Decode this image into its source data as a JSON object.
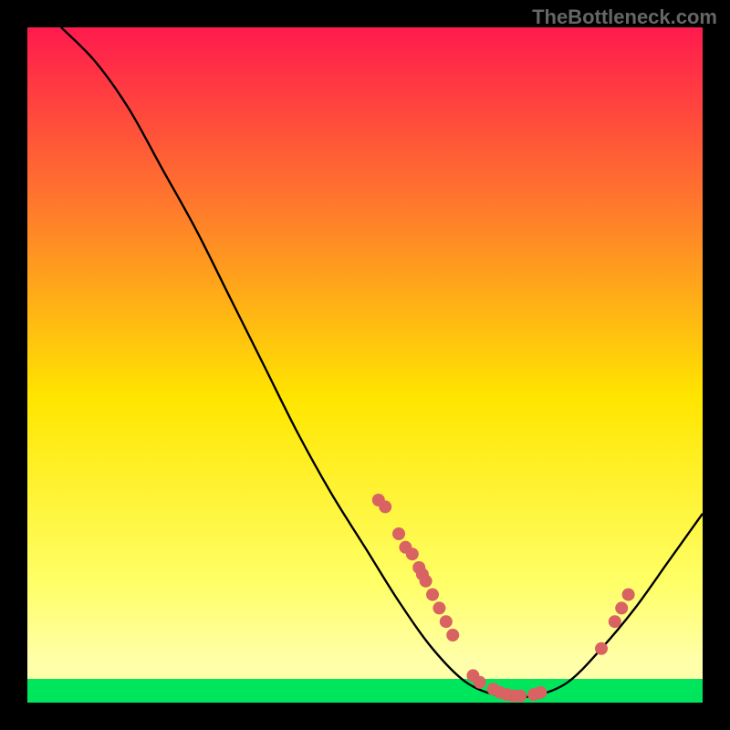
{
  "watermark": "TheBottleneck.com",
  "chart_data": {
    "type": "line",
    "title": "",
    "xlabel": "",
    "ylabel": "",
    "xlim": [
      0,
      100
    ],
    "ylim": [
      0,
      100
    ],
    "background_gradient": {
      "top": "#ff1a4d",
      "mid1": "#ff7f2a",
      "mid2": "#ffe600",
      "mid3": "#ffff66",
      "bottom_band": "#00e65c"
    },
    "curve": [
      {
        "x": 5,
        "y": 100
      },
      {
        "x": 10,
        "y": 95
      },
      {
        "x": 15,
        "y": 88
      },
      {
        "x": 20,
        "y": 79
      },
      {
        "x": 25,
        "y": 70
      },
      {
        "x": 30,
        "y": 60
      },
      {
        "x": 35,
        "y": 50
      },
      {
        "x": 40,
        "y": 40
      },
      {
        "x": 45,
        "y": 31
      },
      {
        "x": 50,
        "y": 23
      },
      {
        "x": 55,
        "y": 15
      },
      {
        "x": 60,
        "y": 8
      },
      {
        "x": 65,
        "y": 3
      },
      {
        "x": 70,
        "y": 1
      },
      {
        "x": 75,
        "y": 1
      },
      {
        "x": 80,
        "y": 3
      },
      {
        "x": 85,
        "y": 8
      },
      {
        "x": 90,
        "y": 14
      },
      {
        "x": 95,
        "y": 21
      },
      {
        "x": 100,
        "y": 28
      }
    ],
    "markers": [
      {
        "x": 52,
        "y": 30
      },
      {
        "x": 53,
        "y": 29
      },
      {
        "x": 55,
        "y": 25
      },
      {
        "x": 56,
        "y": 23
      },
      {
        "x": 57,
        "y": 22
      },
      {
        "x": 58,
        "y": 20
      },
      {
        "x": 58.5,
        "y": 19
      },
      {
        "x": 59,
        "y": 18
      },
      {
        "x": 60,
        "y": 16
      },
      {
        "x": 61,
        "y": 14
      },
      {
        "x": 62,
        "y": 12
      },
      {
        "x": 63,
        "y": 10
      },
      {
        "x": 66,
        "y": 4
      },
      {
        "x": 67,
        "y": 3
      },
      {
        "x": 69,
        "y": 2
      },
      {
        "x": 70,
        "y": 1.5
      },
      {
        "x": 71,
        "y": 1.2
      },
      {
        "x": 72,
        "y": 1
      },
      {
        "x": 73,
        "y": 1
      },
      {
        "x": 75,
        "y": 1.2
      },
      {
        "x": 76,
        "y": 1.5
      },
      {
        "x": 85,
        "y": 8
      },
      {
        "x": 87,
        "y": 12
      },
      {
        "x": 88,
        "y": 14
      },
      {
        "x": 89,
        "y": 16
      }
    ],
    "marker_color": "#d96262",
    "line_color": "#000000"
  }
}
